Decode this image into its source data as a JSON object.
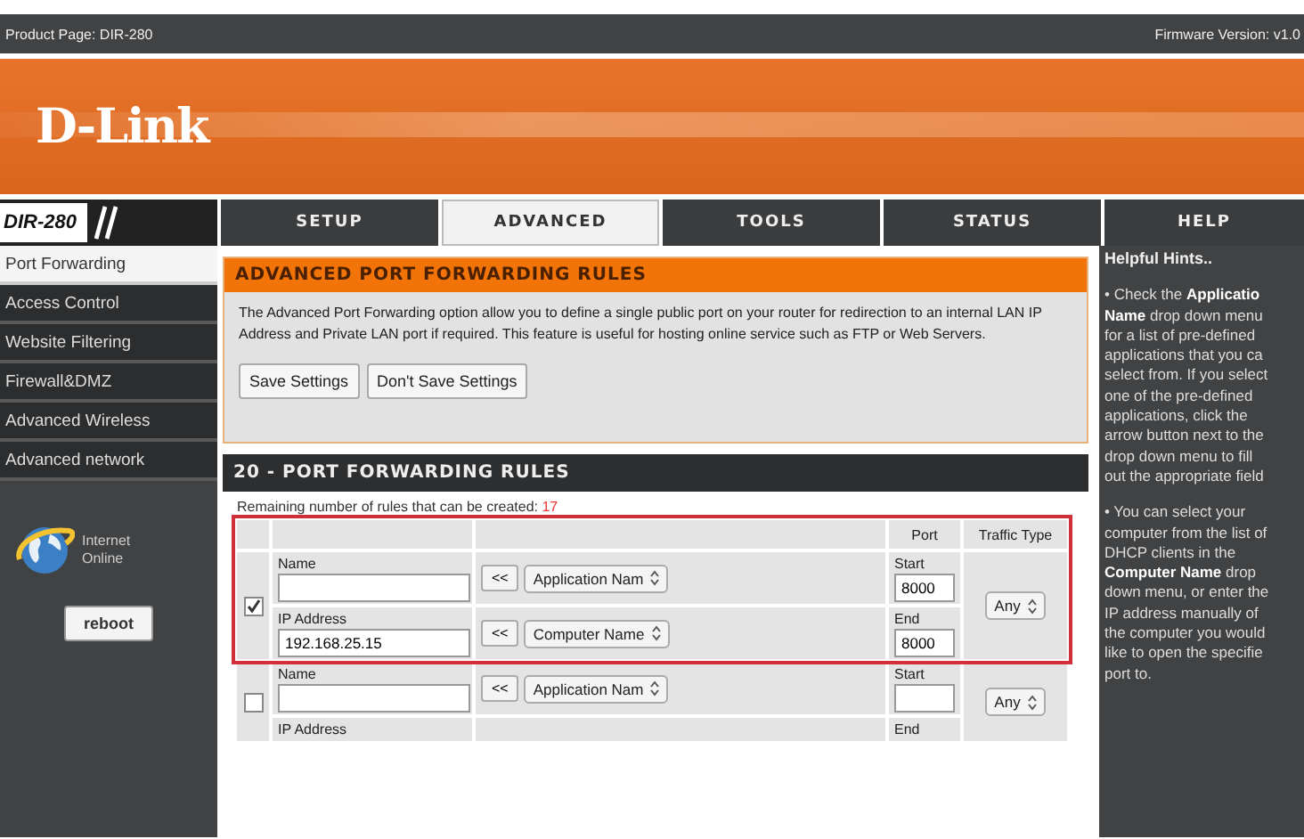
{
  "top_bar": {
    "product": "Product Page: DIR-280",
    "firmware": "Firmware Version: v1.0"
  },
  "logo": "D-Link",
  "model": "DIR-280",
  "tabs": [
    {
      "label": "SETUP",
      "selected": false
    },
    {
      "label": "ADVANCED",
      "selected": true
    },
    {
      "label": "TOOLS",
      "selected": false
    },
    {
      "label": "STATUS",
      "selected": false
    },
    {
      "label": "HELP",
      "selected": false
    }
  ],
  "sidebar": {
    "items": [
      {
        "label": "Port Forwarding",
        "selected": true
      },
      {
        "label": "Access Control",
        "selected": false
      },
      {
        "label": "Website Filtering",
        "selected": false
      },
      {
        "label": "Firewall&DMZ",
        "selected": false
      },
      {
        "label": "Advanced Wireless",
        "selected": false
      },
      {
        "label": "Advanced network",
        "selected": false
      }
    ],
    "status": [
      "Internet",
      "Online"
    ],
    "reboot": "reboot"
  },
  "intro": {
    "title": "ADVANCED PORT FORWARDING RULES",
    "text": "The Advanced Port Forwarding option allow you to define a single public port on your router for redirection to an internal LAN IP Address and Private LAN port if required. This feature is useful for hosting online service such as FTP or Web Servers.",
    "buttons": [
      "Save Settings",
      "Don't Save Settings"
    ]
  },
  "rules": {
    "title": "20 - PORT FORWARDING RULES",
    "remaining_label": "Remaining number of rules that can be created:",
    "remaining": "17",
    "columns": [
      "Port",
      "Traffic Type"
    ],
    "rows": [
      {
        "checked": true,
        "highlighted": true,
        "name_label": "Name",
        "name": "",
        "ip_label": "IP Address",
        "ip": "192.168.25.15",
        "arrow1": "<<",
        "app_select": "Application Nam",
        "arrow2": "<<",
        "computer_select": "Computer Name",
        "start_label": "Start",
        "start": "8000",
        "end_label": "End",
        "end": "8000",
        "traffic": "Any"
      },
      {
        "checked": false,
        "highlighted": false,
        "name_label": "Name",
        "name": "",
        "ip_label": "IP Address",
        "arrow1": "<<",
        "app_select": "Application Nam",
        "start_label": "Start",
        "start": "",
        "end_label": "End",
        "traffic": "Any"
      }
    ]
  },
  "help": {
    "title": "Helpful Hints..",
    "paragraphs": [
      [
        "• Check the **Applicatio**",
        "**Name** drop down menu",
        "for a list of pre-defined",
        "applications that you ca",
        "select from. If you select",
        "one of the pre-defined",
        "applications, click the",
        "arrow button next to the",
        "drop down menu to fill",
        "out the appropriate field"
      ],
      [
        "• You can select your",
        "computer from the list of",
        "DHCP clients in the",
        "**Computer Name** drop",
        "down menu, or enter the",
        "IP address manually of",
        "the computer you would",
        "like to open the specifie",
        "port to."
      ]
    ]
  }
}
